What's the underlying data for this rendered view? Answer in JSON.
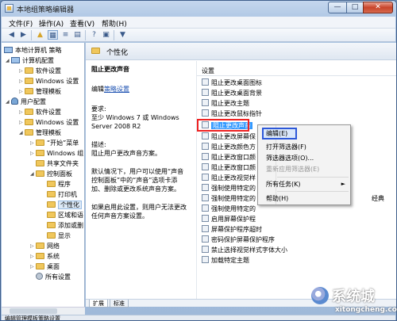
{
  "window": {
    "title": "本地组策略编辑器",
    "controls": {
      "minimize": "—",
      "maximize": "□",
      "close": "✕"
    }
  },
  "menubar": [
    "文件(F)",
    "操作(A)",
    "查看(V)",
    "帮助(H)"
  ],
  "toolbar": {
    "icons": [
      "back-arrow-icon",
      "forward-arrow-icon",
      "up-folder-icon",
      "show-tree-icon",
      "list-icon",
      "export-icon",
      "help-icon",
      "properties-icon",
      "filter-icon"
    ]
  },
  "tree": {
    "root": "本地计算机 策略",
    "computer_config": "计算机配置",
    "cc_items": [
      "软件设置",
      "Windows 设置",
      "管理模板"
    ],
    "user_config": "用户配置",
    "uc_items": [
      "软件设置",
      "Windows 设置",
      "管理模板"
    ],
    "admin_items": [
      "“开始”菜单",
      "Windows 组",
      "共享文件夹",
      "控制面板"
    ],
    "cp_items": [
      "程序",
      "打印机",
      "个性化",
      "区域和语",
      "添加或删",
      "显示"
    ],
    "more_items": [
      "网络",
      "系统",
      "桌面",
      "所有设置"
    ]
  },
  "right_header": {
    "title": "个性化"
  },
  "description": {
    "heading": "阻止更改声音",
    "edit_label": "编辑",
    "edit_link": "策略设置",
    "requirements_label": "要求:",
    "requirements_text": "至少 Windows 7 或 Windows Server 2008 R2",
    "desc_label": "描述:",
    "desc_text": "阻止用户更改声音方案。",
    "para1": "默认情况下，用户可以使用“声音控制面板”中的“声音”选项卡添加、删除或更改系统声音方案。",
    "para2": "如果启用此设置，则用户无法更改任何声音方案设置。"
  },
  "list": {
    "column_header": "设置",
    "items": [
      "阻止更改桌面图标",
      "阻止更改桌面背景",
      "阻止更改主题",
      "阻止更改鼠标指针",
      "阻止更改声音",
      "阻止更改屏幕保",
      "阻止更改颜色方",
      "阻止更改窗口颜",
      "阻止更改窗口颜",
      "阻止更改视觉样",
      "强制使用特定的",
      "强制使用特定的",
      "强制使用特定的",
      "启用屏幕保护程",
      "屏幕保护程序超时",
      "密码保护屏幕保护程序",
      "禁止选择视觉样式字体大小",
      "加载特定主题"
    ],
    "selected_index": 4,
    "partial_suffix": "经典"
  },
  "context_menu": {
    "items": [
      {
        "label": "编辑(E)",
        "disabled": false
      },
      {
        "label": "打开筛选器(F)",
        "disabled": false
      },
      {
        "label": "筛选器选项(O)...",
        "disabled": false
      },
      {
        "label": "重新应用筛选器(E)",
        "disabled": true
      },
      {
        "label": "所有任务(K)",
        "disabled": false,
        "arrow": "►"
      },
      {
        "label": "帮助(H)",
        "disabled": false
      }
    ]
  },
  "tabs": [
    "扩展",
    "标准"
  ],
  "status": "编辑管理模板策略设置",
  "watermark": {
    "text": "系统城",
    "url": "xitongcheng.com"
  }
}
